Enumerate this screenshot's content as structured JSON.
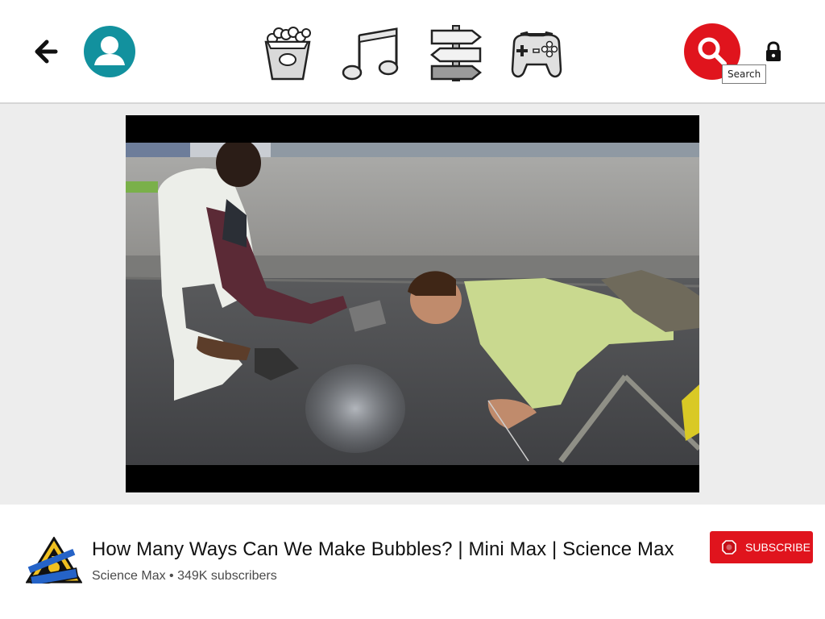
{
  "header": {
    "back_icon": "arrow-left-icon",
    "profile_icon": "user-avatar-icon",
    "categories": [
      {
        "name": "movies",
        "icon": "popcorn-icon"
      },
      {
        "name": "music",
        "icon": "music-notes-icon"
      },
      {
        "name": "explore",
        "icon": "signpost-icon"
      },
      {
        "name": "games",
        "icon": "gamepad-icon"
      }
    ],
    "search_icon": "search-icon",
    "search_tooltip": "Search",
    "lock_icon": "lock-icon",
    "accent": "#e0141d",
    "avatar_color": "#12919e"
  },
  "video": {
    "title": "How Many Ways Can We Make Bubbles? | Mini Max | Science Max",
    "channel_meta": "Science Max • 349K subscribers",
    "subscribe_label": "SUBSCRIBE"
  }
}
